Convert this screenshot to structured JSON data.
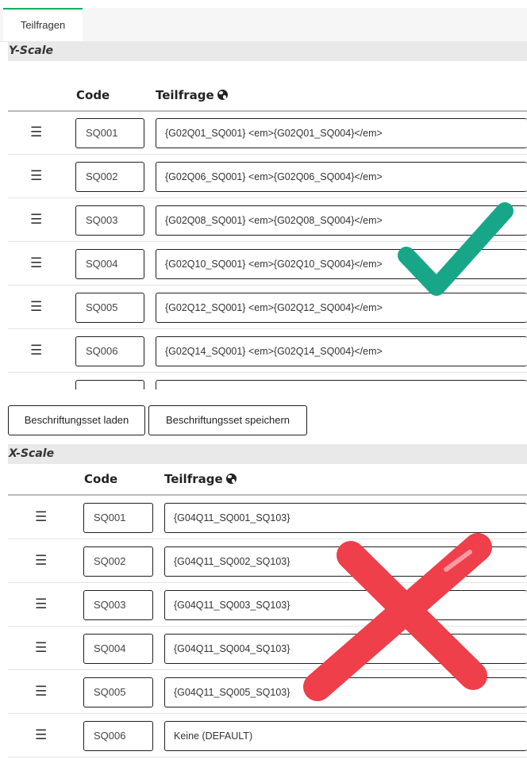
{
  "tabs": [
    {
      "label": "Teilfragen"
    }
  ],
  "y_scale": {
    "title": "Y-Scale",
    "columns": {
      "code": "Code",
      "subquestion": "Teilfrage"
    },
    "rows": [
      {
        "code": "SQ001",
        "text": "{G02Q01_SQ001} <em>{G02Q01_SQ004}</em>"
      },
      {
        "code": "SQ002",
        "text": "{G02Q06_SQ001} <em>{G02Q06_SQ004}</em>"
      },
      {
        "code": "SQ003",
        "text": "{G02Q08_SQ001} <em>{G02Q08_SQ004}</em>"
      },
      {
        "code": "SQ004",
        "text": "{G02Q10_SQ001} <em>{G02Q10_SQ004}</em>"
      },
      {
        "code": "SQ005",
        "text": "{G02Q12_SQ001} <em>{G02Q12_SQ004}</em>"
      },
      {
        "code": "SQ006",
        "text": "{G02Q14_SQ001} <em>{G02Q14_SQ004}</em>"
      }
    ]
  },
  "label_buttons": {
    "load": "Beschriftungsset laden",
    "save": "Beschriftungsset speichern"
  },
  "x_scale": {
    "title": "X-Scale",
    "columns": {
      "code": "Code",
      "subquestion": "Teilfrage"
    },
    "rows": [
      {
        "code": "SQ001",
        "text": "{G04Q11_SQ001_SQ103}"
      },
      {
        "code": "SQ002",
        "text": "{G04Q11_SQ002_SQ103}"
      },
      {
        "code": "SQ003",
        "text": "{G04Q11_SQ003_SQ103}"
      },
      {
        "code": "SQ004",
        "text": "{G04Q11_SQ004_SQ103}"
      },
      {
        "code": "SQ005",
        "text": "{G04Q11_SQ005_SQ103}"
      },
      {
        "code": "SQ006",
        "text": "Keine (DEFAULT)"
      }
    ]
  },
  "icons": {
    "drag": "drag-handle-icon",
    "globe": "globe-icon",
    "check": "check-mark-icon",
    "cross": "cross-mark-icon"
  },
  "colors": {
    "tab_accent": "#14ae5c",
    "check": "#17a688",
    "cross": "#ee3f4a"
  }
}
